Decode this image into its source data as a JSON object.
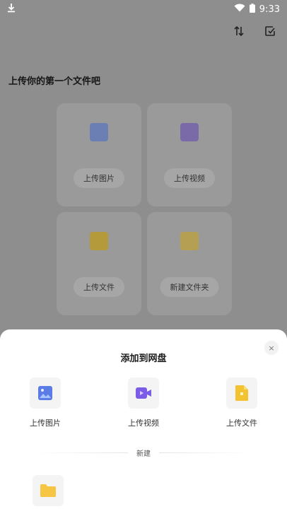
{
  "status_bar": {
    "time": "9:33"
  },
  "page": {
    "heading": "上传你的第一个文件吧"
  },
  "grid": {
    "items": [
      {
        "label": "上传图片"
      },
      {
        "label": "上传视频"
      },
      {
        "label": "上传文件"
      },
      {
        "label": "新建文件夹"
      }
    ]
  },
  "sheet": {
    "title": "添加到网盘",
    "close": "×",
    "options": [
      {
        "label": "上传图片"
      },
      {
        "label": "上传视频"
      },
      {
        "label": "上传文件"
      }
    ],
    "divider_label": "新建"
  },
  "colors": {
    "image_blue": "#5b7be6",
    "video_purple": "#7b5ce6",
    "file_yellow": "#f2c230",
    "folder_yellow": "#f6c544"
  }
}
